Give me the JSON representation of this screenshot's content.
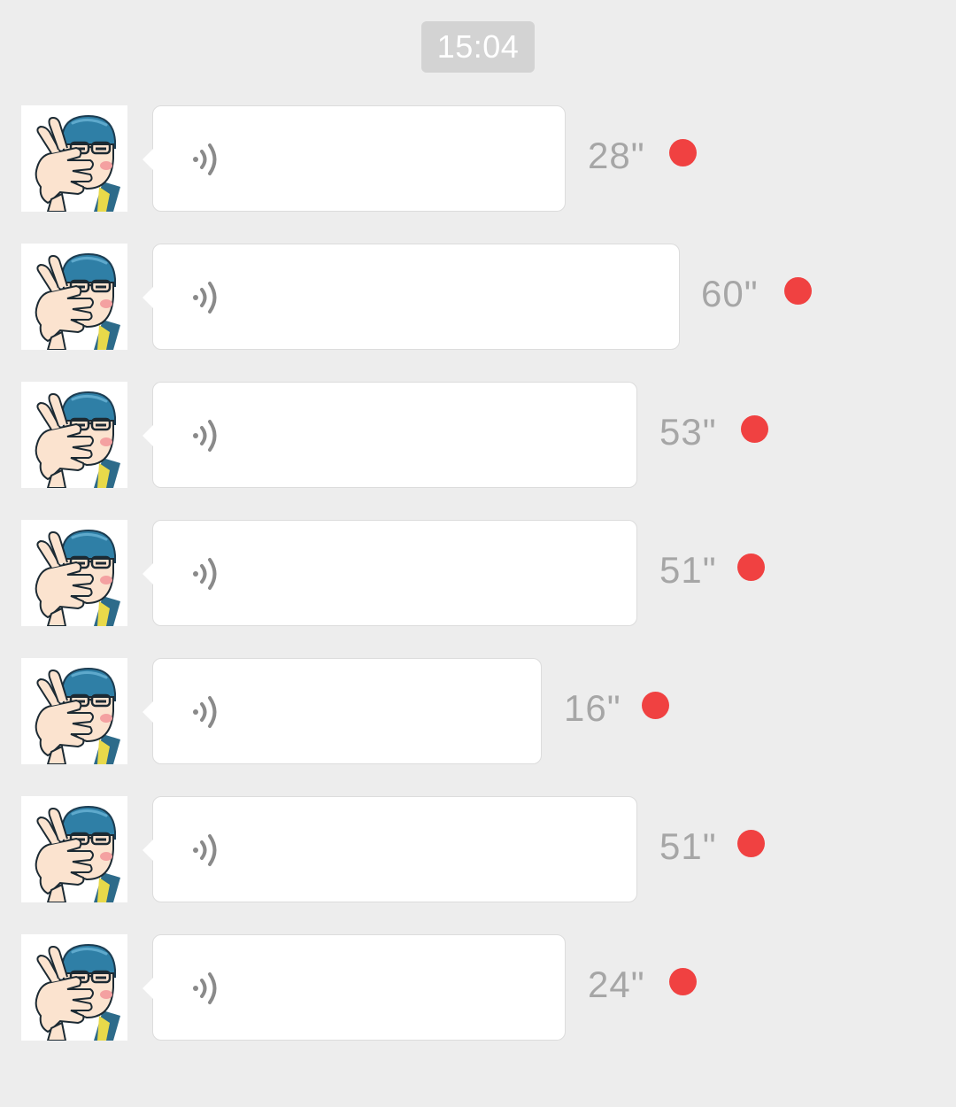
{
  "timestamp": "15:04",
  "messages": [
    {
      "duration": "28\"",
      "unread": true
    },
    {
      "duration": "60\"",
      "unread": true
    },
    {
      "duration": "53\"",
      "unread": true
    },
    {
      "duration": "51\"",
      "unread": true
    },
    {
      "duration": "16\"",
      "unread": true
    },
    {
      "duration": "51\"",
      "unread": true
    },
    {
      "duration": "24\"",
      "unread": true
    }
  ],
  "icons": {
    "avatar": "cartoon-face-palm-avatar",
    "voice": "voice-wave-icon"
  },
  "colors": {
    "background": "#ededed",
    "bubble": "#ffffff",
    "duration_text": "#a6a6a6",
    "unread_dot": "#f04141",
    "time_badge": "#d3d3d3"
  }
}
